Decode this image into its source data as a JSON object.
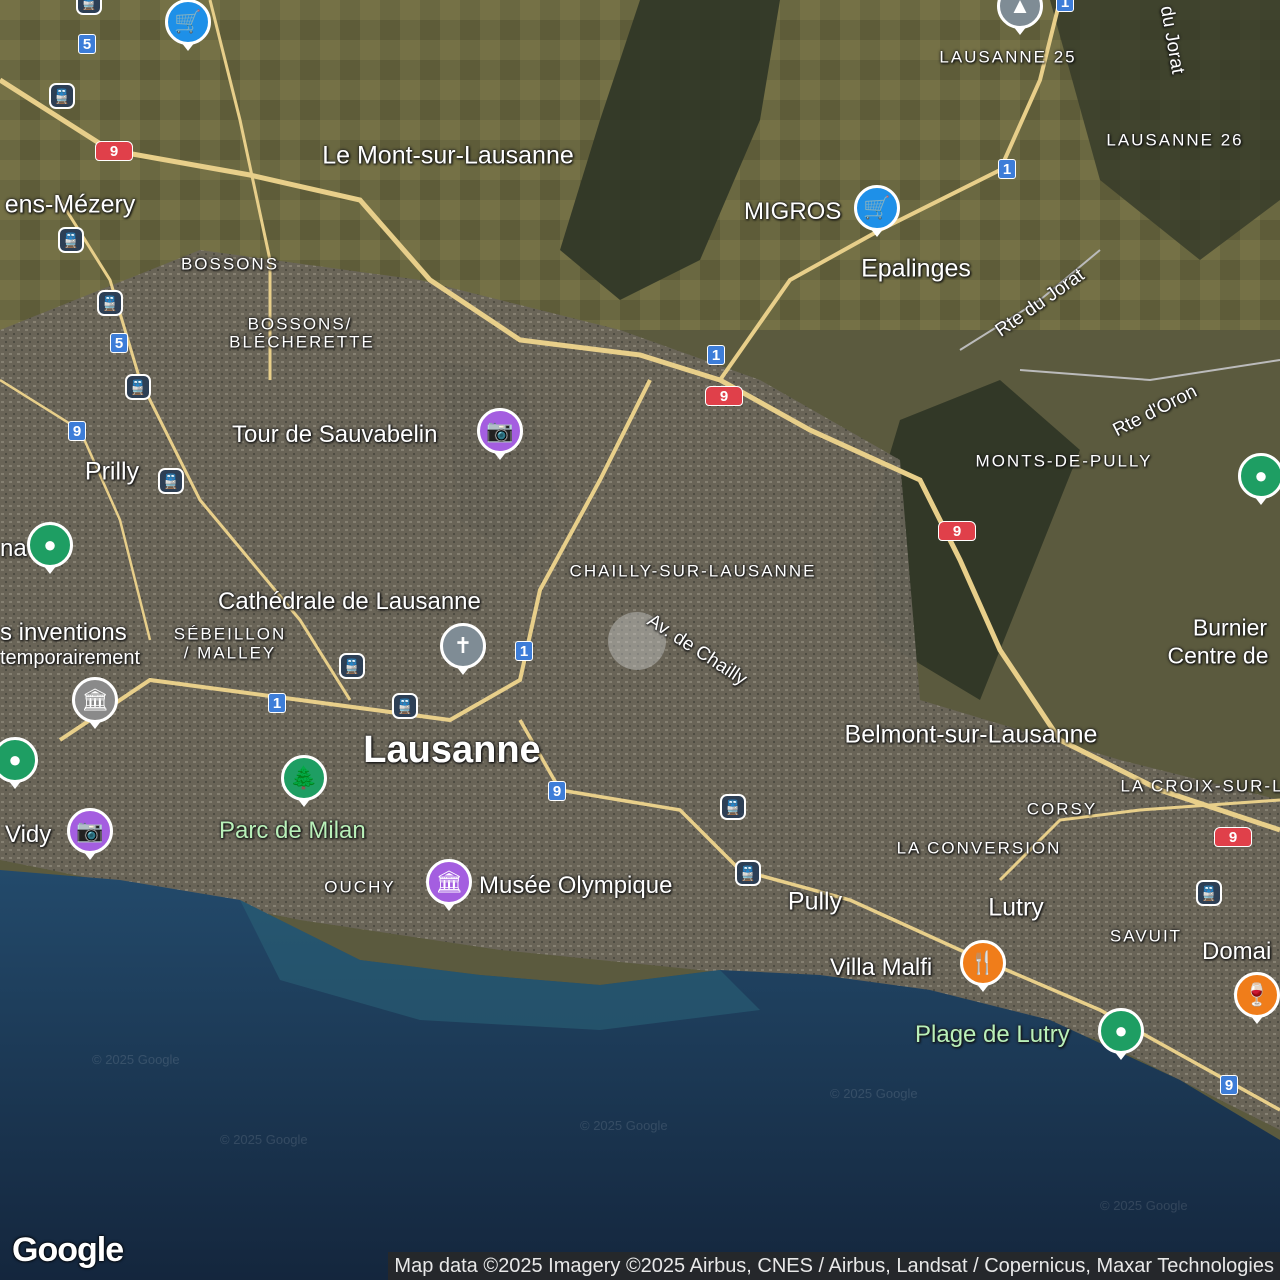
{
  "colors": {
    "land": "#5b5a3e",
    "urban": "#6b6558",
    "lake": "#1f3c5e",
    "road_main": "#e8cf8a",
    "shield_blue": "#3d7dd8",
    "shield_red": "#e0404a",
    "poi_shopping": "#1e90e8",
    "poi_attraction": "#a45ee0",
    "poi_museum": "#8a8a8a",
    "poi_park": "#1e9e63",
    "poi_food": "#f07d1a",
    "poi_worship": "#7f8c95"
  },
  "labels": {
    "places": [
      {
        "id": "lausanne",
        "text": "Lausanne",
        "size": "lg"
      },
      {
        "id": "le-mont",
        "text": "Le Mont-sur-Lausanne",
        "size": "md"
      },
      {
        "id": "epalinges",
        "text": "Epalinges",
        "size": "md"
      },
      {
        "id": "prilly",
        "text": "Prilly",
        "size": "md"
      },
      {
        "id": "belmont",
        "text": "Belmont-sur-Lausanne",
        "size": "md"
      },
      {
        "id": "pully",
        "text": "Pully",
        "size": "md"
      },
      {
        "id": "lutry",
        "text": "Lutry",
        "size": "md"
      },
      {
        "id": "romanel",
        "text": "ens-Mézery",
        "size": "md"
      },
      {
        "id": "burnier",
        "text": "Burnier",
        "size": "sm"
      },
      {
        "id": "centre",
        "text": "Centre de",
        "size": "sm"
      }
    ],
    "districts": [
      {
        "id": "lausanne-25",
        "text": "LAUSANNE 25"
      },
      {
        "id": "lausanne-26",
        "text": "LAUSANNE 26"
      },
      {
        "id": "bossons",
        "text": "BOSSONS"
      },
      {
        "id": "bossons-blecherette-1",
        "text": "BOSSONS/"
      },
      {
        "id": "bossons-blecherette-2",
        "text": "BLÉCHERETTE"
      },
      {
        "id": "monts-de-pully",
        "text": "MONTS-DE-PULLY"
      },
      {
        "id": "chailly",
        "text": "CHAILLY-SUR-LAUSANNE"
      },
      {
        "id": "sebeillon-1",
        "text": "SÉBEILLON"
      },
      {
        "id": "sebeillon-2",
        "text": "/ MALLEY"
      },
      {
        "id": "corsy",
        "text": "CORSY"
      },
      {
        "id": "la-conversion",
        "text": "LA CONVERSION"
      },
      {
        "id": "la-croix",
        "text": "LA CROIX-SUR-L"
      },
      {
        "id": "ouchy",
        "text": "OUCHY"
      },
      {
        "id": "savuit",
        "text": "SAVUIT"
      }
    ],
    "pois": [
      {
        "id": "migros",
        "text": "MIGROS",
        "icon": "shopping-cart-icon"
      },
      {
        "id": "sauvabelin",
        "text": "Tour de Sauvabelin",
        "icon": "camera-icon"
      },
      {
        "id": "cathedrale",
        "text": "Cathédrale de Lausanne",
        "icon": "cross-icon"
      },
      {
        "id": "inventions",
        "text": "s inventions",
        "icon": "museum-icon"
      },
      {
        "id": "inventions-2",
        "text": "temporairement",
        "icon": ""
      },
      {
        "id": "parc-milan",
        "text": "Parc de Milan",
        "icon": "tree-icon"
      },
      {
        "id": "vidy",
        "text": "Vidy",
        "icon": "camera-icon"
      },
      {
        "id": "musee-olympique",
        "text": "Musée Olympique",
        "icon": "museum-icon"
      },
      {
        "id": "villa-malfi",
        "text": "Villa Malfi",
        "icon": "restaurant-icon"
      },
      {
        "id": "plage-lutry",
        "text": "Plage de Lutry",
        "icon": "park-icon"
      },
      {
        "id": "domai",
        "text": "Domai",
        "icon": "wine-icon"
      },
      {
        "id": "ma",
        "text": "na",
        "icon": "park-icon"
      }
    ],
    "roads": [
      {
        "id": "rte-jorat",
        "text": "Rte du Jorat"
      },
      {
        "id": "rte-oron",
        "text": "Rte d'Oron"
      },
      {
        "id": "av-chailly",
        "text": "Av. de Chailly"
      },
      {
        "id": "du-jorat",
        "text": "du Jorat"
      }
    ],
    "shields": [
      "5",
      "9",
      "1"
    ]
  },
  "logo": "Google",
  "attribution": "Map data ©2025 Imagery ©2025 Airbus, CNES / Airbus, Landsat / Copernicus, Maxar Technologies",
  "watermark": "© 2025 Google"
}
